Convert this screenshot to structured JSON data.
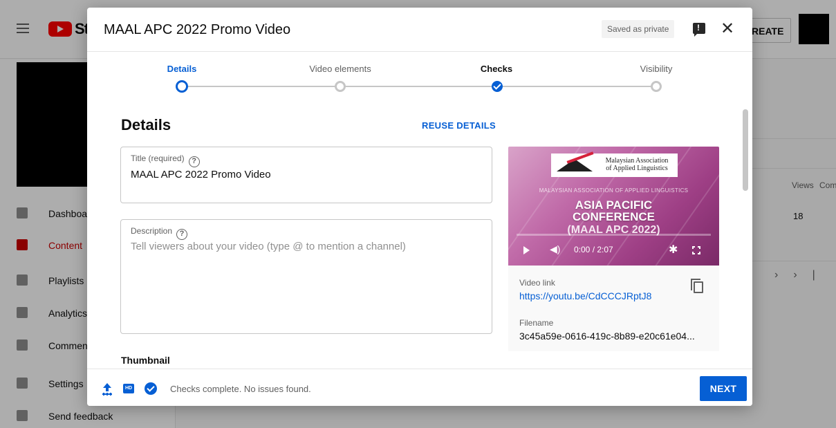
{
  "background": {
    "logo_text": "St",
    "create_label": "REATE",
    "nav": [
      {
        "label": "Dashboard",
        "icon": "dashboard-icon"
      },
      {
        "label": "Content",
        "icon": "content-icon",
        "active": true
      },
      {
        "label": "Playlists",
        "icon": "playlists-icon"
      },
      {
        "label": "Analytics",
        "icon": "analytics-icon"
      },
      {
        "label": "Comments",
        "icon": "comments-icon"
      },
      {
        "label": "Settings",
        "icon": "settings-icon"
      },
      {
        "label": "Send feedback",
        "icon": "feedback-icon"
      }
    ],
    "table": {
      "views_header": "Views",
      "comments_header": "Com",
      "views_value": "18",
      "pager_next": "›",
      "pager_last": "›|"
    }
  },
  "dialog": {
    "title": "MAAL APC 2022 Promo Video",
    "saved_badge": "Saved as private",
    "close_symbol": "✕",
    "steps": [
      {
        "label": "Details",
        "state": "current"
      },
      {
        "label": "Video elements",
        "state": "incomplete"
      },
      {
        "label": "Checks",
        "state": "done"
      },
      {
        "label": "Visibility",
        "state": "incomplete"
      }
    ],
    "section_title": "Details",
    "reuse_label": "REUSE DETAILS",
    "title_field": {
      "label": "Title (required)",
      "value": "MAAL APC 2022 Promo Video"
    },
    "description_field": {
      "label": "Description",
      "placeholder": "Tell viewers about your video (type @ to mention a channel)"
    },
    "thumbnail_heading": "Thumbnail",
    "preview": {
      "org_line1": "Malaysian Association",
      "org_line2": "of Applied Linguistics",
      "assoc_line": "MALAYSIAN ASSOCIATION OF APPLIED LINGUISTICS",
      "conf_line1": "ASIA PACIFIC",
      "conf_line2": "CONFERENCE",
      "conf_line3": "(MAAL APC 2022)",
      "time": "0:00 / 2:07",
      "video_link_label": "Video link",
      "video_link": "https://youtu.be/CdCCCJRptJ8",
      "filename_label": "Filename",
      "filename": "3c45a59e-0616-419c-8b89-e20c61e04..."
    },
    "footer": {
      "status": "Checks complete. No issues found.",
      "next_label": "NEXT",
      "hd_label": "HD"
    }
  },
  "colors": {
    "accent": "#065fd4",
    "active_nav": "#cc0000"
  }
}
